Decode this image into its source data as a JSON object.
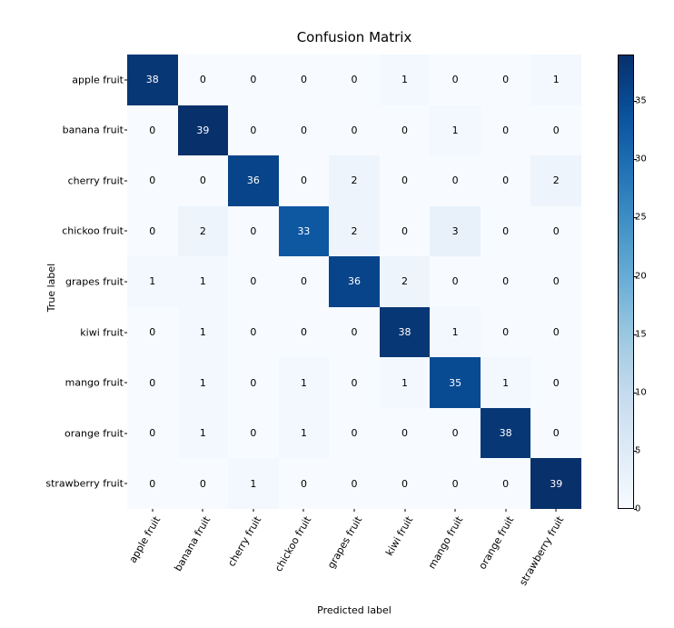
{
  "chart_data": {
    "type": "heatmap",
    "title": "Confusion Matrix",
    "xlabel": "Predicted label",
    "ylabel": "True label",
    "vmin": 0,
    "vmax": 39,
    "categories": [
      "apple fruit",
      "banana fruit",
      "cherry fruit",
      "chickoo fruit",
      "grapes fruit",
      "kiwi fruit",
      "mango fruit",
      "orange fruit",
      "strawberry fruit"
    ],
    "matrix": [
      [
        38,
        0,
        0,
        0,
        0,
        1,
        0,
        0,
        1
      ],
      [
        0,
        39,
        0,
        0,
        0,
        0,
        1,
        0,
        0
      ],
      [
        0,
        0,
        36,
        0,
        2,
        0,
        0,
        0,
        2
      ],
      [
        0,
        2,
        0,
        33,
        2,
        0,
        3,
        0,
        0
      ],
      [
        1,
        1,
        0,
        0,
        36,
        2,
        0,
        0,
        0
      ],
      [
        0,
        1,
        0,
        0,
        0,
        38,
        1,
        0,
        0
      ],
      [
        0,
        1,
        0,
        1,
        0,
        1,
        35,
        1,
        0
      ],
      [
        0,
        1,
        0,
        1,
        0,
        0,
        0,
        38,
        0
      ],
      [
        0,
        0,
        1,
        0,
        0,
        0,
        0,
        0,
        39
      ]
    ],
    "colorbar_ticks": [
      0,
      5,
      10,
      15,
      20,
      25,
      30,
      35
    ]
  }
}
